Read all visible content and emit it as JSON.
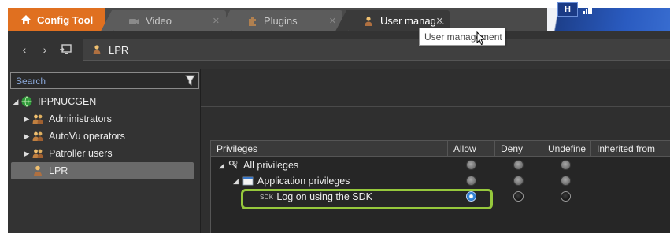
{
  "tabs": {
    "home": {
      "label": "Config Tool",
      "icon": "home-icon"
    },
    "items": [
      {
        "label": "Video",
        "icon": "video-camera-icon",
        "active": false
      },
      {
        "label": "Plugins",
        "icon": "puzzle-icon",
        "active": false
      },
      {
        "label": "User manag...",
        "icon": "user-icon",
        "active": true
      }
    ],
    "tooltip": "User management"
  },
  "status": {
    "box_label": "H"
  },
  "nav": {
    "back": "back-arrow-icon",
    "forward": "forward-arrow-icon",
    "pin": "pin-screen-icon",
    "address": "LPR"
  },
  "search": {
    "placeholder": "Search"
  },
  "tree": [
    {
      "label": "IPPNUCGEN",
      "icon": "server-globe-icon",
      "expanded": true,
      "level": 0
    },
    {
      "label": "Administrators",
      "icon": "user-group-icon",
      "level": 1
    },
    {
      "label": "AutoVu operators",
      "icon": "user-group-icon",
      "level": 1
    },
    {
      "label": "Patroller users",
      "icon": "user-group-icon",
      "level": 1
    },
    {
      "label": "LPR",
      "icon": "user-icon",
      "level": 1,
      "selected": true
    }
  ],
  "privileges": {
    "columns": [
      "Privileges",
      "Allow",
      "Deny",
      "Undefine",
      "Inherited from"
    ],
    "rows": [
      {
        "label": "All privileges",
        "icon": "keys-icon",
        "allow": "grey",
        "deny": "grey",
        "undefined": "grey"
      },
      {
        "label": "Application privileges",
        "icon": "window-icon",
        "allow": "grey",
        "deny": "grey",
        "undefined": "grey"
      },
      {
        "label": "Log on using the SDK",
        "prefix": "SDK",
        "icon": "sdk-icon",
        "allow": "selected",
        "deny": "dark",
        "undefined": "dark"
      }
    ]
  },
  "colors": {
    "accent": "#e07020",
    "highlight": "#96c83c",
    "radio_selected": "#2a6fc4"
  }
}
